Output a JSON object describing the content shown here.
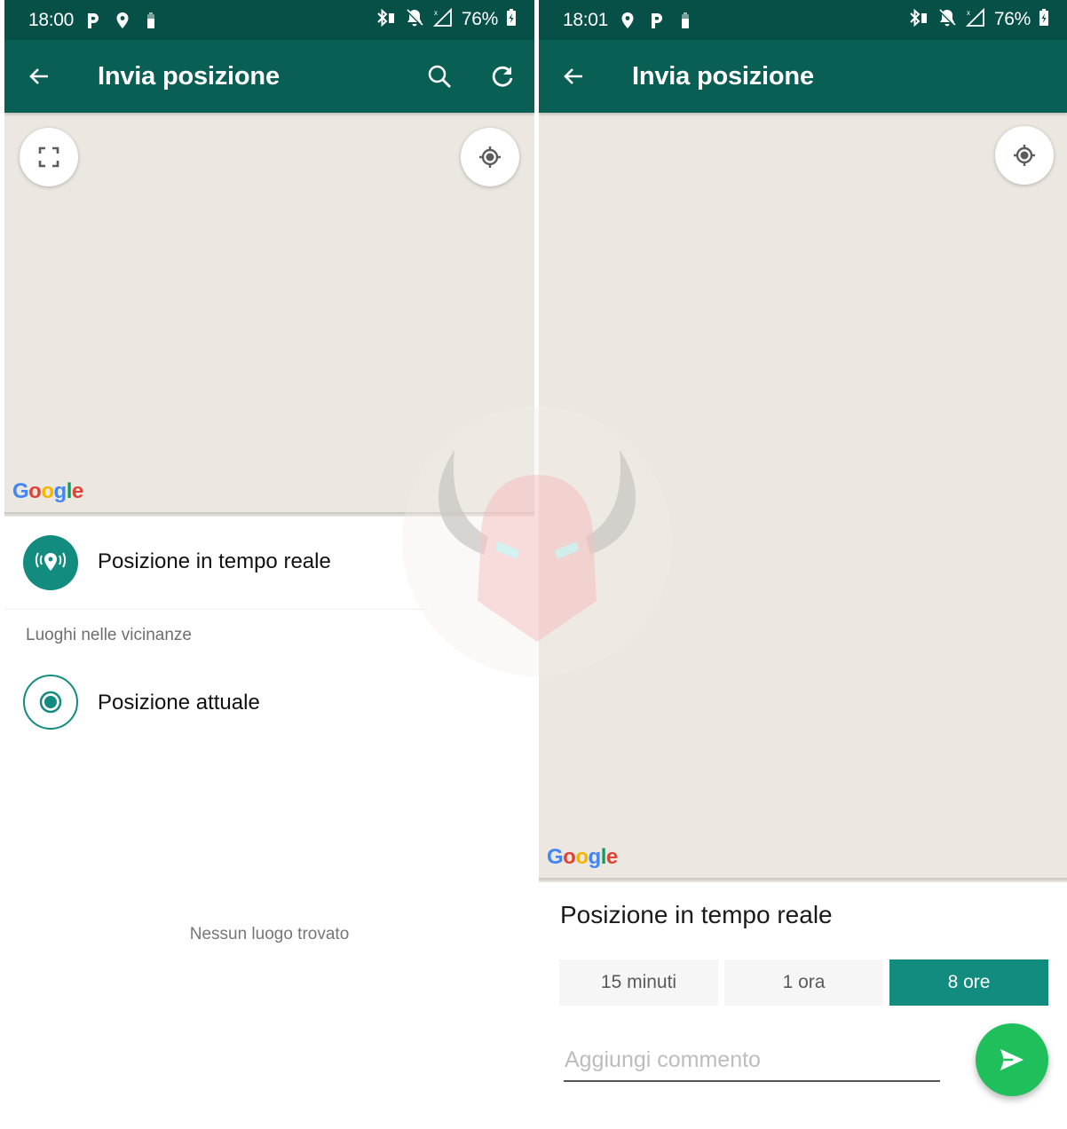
{
  "left_screen": {
    "status_bar": {
      "time": "18:00",
      "left_icons": [
        "parking-icon",
        "location-pin-icon",
        "battery-small-icon"
      ],
      "right_icons": [
        "bluetooth-icon",
        "notifications-off-icon",
        "no-signal-icon"
      ],
      "battery_percent": "76%"
    },
    "app_bar": {
      "title": "Invia posizione",
      "back_icon": "arrow-back-icon",
      "actions": [
        "search-icon",
        "refresh-icon"
      ]
    },
    "map": {
      "fullscreen_icon": "fullscreen-icon",
      "locate_icon": "my-location-icon",
      "attribution": "Google"
    },
    "live_location_row": {
      "label": "Posizione in tempo reale",
      "icon": "live-location-icon"
    },
    "nearby_header": "Luoghi nelle vicinanze",
    "current_location_row": {
      "label": "Posizione attuale",
      "icon": "current-location-icon"
    },
    "empty_state": "Nessun luogo trovato"
  },
  "right_screen": {
    "status_bar": {
      "time": "18:01",
      "left_icons": [
        "location-pin-icon",
        "parking-icon",
        "battery-small-icon"
      ],
      "right_icons": [
        "bluetooth-icon",
        "notifications-off-icon",
        "no-signal-icon"
      ],
      "battery_percent": "76%"
    },
    "app_bar": {
      "title": "Invia posizione",
      "back_icon": "arrow-back-icon"
    },
    "map": {
      "locate_icon": "my-location-icon",
      "attribution": "Google"
    },
    "live_panel": {
      "title": "Posizione in tempo reale",
      "durations": [
        {
          "label": "15 minuti",
          "selected": false
        },
        {
          "label": "1 ora",
          "selected": false
        },
        {
          "label": "8 ore",
          "selected": true
        }
      ],
      "comment_placeholder": "Aggiungi commento",
      "comment_value": "",
      "send_icon": "send-icon"
    }
  },
  "colors": {
    "status_bar": "#075048",
    "app_bar": "#0a5f55",
    "accent": "#128c7e",
    "send_button": "#1fc05b",
    "map_background": "#ece7e0"
  },
  "watermark": "horned-helmet-logo"
}
